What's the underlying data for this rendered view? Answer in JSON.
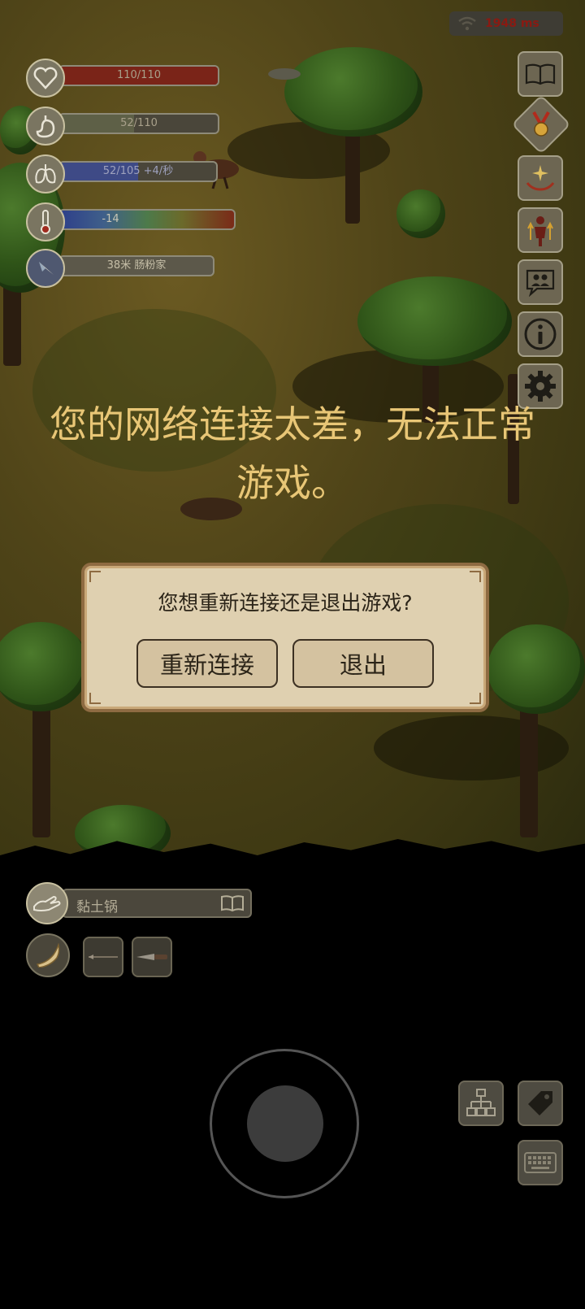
{
  "status": {
    "network": {
      "text": "1948 ms",
      "icon": "wifi-icon"
    },
    "health": {
      "text": "110/110",
      "icon": "heart-icon",
      "level": 1.0,
      "color": "#7a2418"
    },
    "hunger": {
      "text": "52/110",
      "icon": "stomach-icon",
      "level": 0.47,
      "color": "#5e6047"
    },
    "oxygen": {
      "text": "52/105 +4/秒",
      "icon": "lungs-icon",
      "level": 0.5,
      "color": "#3e4a86"
    },
    "temperature": {
      "text": "-14",
      "icon": "thermometer-icon"
    },
    "compass": {
      "text": "38米 肠粉家",
      "icon": "compass-icon"
    }
  },
  "side_menu": [
    {
      "name": "recipe-book",
      "icon": "book-icon"
    },
    {
      "name": "achievements",
      "icon": "medal-icon"
    },
    {
      "name": "skills",
      "icon": "sparkle-hands-icon"
    },
    {
      "name": "character",
      "icon": "person-upgrade-icon"
    },
    {
      "name": "social",
      "icon": "chat-people-icon"
    },
    {
      "name": "info",
      "icon": "info-icon"
    },
    {
      "name": "settings",
      "icon": "gear-icon"
    }
  ],
  "network_warning": "您的网络连接太差，无法正常游戏。",
  "dialog": {
    "message": "您想重新连接还是退出游戏?",
    "reconnect_label": "重新连接",
    "exit_label": "退出"
  },
  "crafting": {
    "item_name": "黏土锅",
    "hand_icon": "hand-icon",
    "book_icon": "open-book-icon"
  },
  "inventory": [
    {
      "name": "horn",
      "icon": "horn-icon"
    },
    {
      "name": "spear",
      "icon": "spear-icon"
    },
    {
      "name": "knife",
      "icon": "knife-icon"
    }
  ],
  "bottom_controls": [
    {
      "name": "tech-tree",
      "icon": "hierarchy-icon"
    },
    {
      "name": "tag",
      "icon": "tag-icon"
    },
    {
      "name": "keyboard",
      "icon": "keyboard-icon"
    }
  ]
}
